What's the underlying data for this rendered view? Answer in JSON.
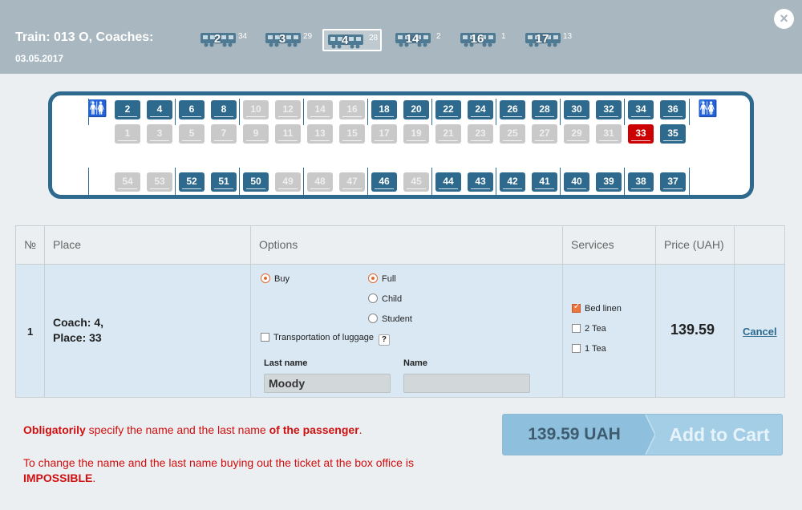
{
  "header": {
    "title": "Train: 013 O, Coaches:",
    "date": "03.05.2017",
    "close_label": "×",
    "coaches": [
      {
        "number": "2",
        "free": "34",
        "selected": false
      },
      {
        "number": "3",
        "free": "29",
        "selected": false
      },
      {
        "number": "4",
        "free": "28",
        "selected": true
      },
      {
        "number": "14",
        "free": "2",
        "selected": false
      },
      {
        "number": "16",
        "free": "1",
        "selected": false
      },
      {
        "number": "17",
        "free": "13",
        "selected": false
      }
    ]
  },
  "scheme": {
    "compartments": [
      {
        "top_upper": "2",
        "top_upper_status": "free",
        "top_lower": "1",
        "top_lower_status": "taken",
        "right_upper": "4",
        "right_upper_status": "free",
        "right_lower": "3",
        "right_lower_status": "taken",
        "side_left": "54",
        "side_left_status": "taken",
        "side_right": "53",
        "side_right_status": "taken"
      },
      {
        "top_upper": "6",
        "top_upper_status": "free",
        "top_lower": "5",
        "top_lower_status": "taken",
        "right_upper": "8",
        "right_upper_status": "free",
        "right_lower": "7",
        "right_lower_status": "taken",
        "side_left": "52",
        "side_left_status": "free",
        "side_right": "51",
        "side_right_status": "free"
      },
      {
        "top_upper": "10",
        "top_upper_status": "taken",
        "top_lower": "9",
        "top_lower_status": "taken",
        "right_upper": "12",
        "right_upper_status": "taken",
        "right_lower": "11",
        "right_lower_status": "taken",
        "side_left": "50",
        "side_left_status": "free",
        "side_right": "49",
        "side_right_status": "taken"
      },
      {
        "top_upper": "14",
        "top_upper_status": "taken",
        "top_lower": "13",
        "top_lower_status": "taken",
        "right_upper": "16",
        "right_upper_status": "taken",
        "right_lower": "15",
        "right_lower_status": "taken",
        "side_left": "48",
        "side_left_status": "taken",
        "side_right": "47",
        "side_right_status": "taken"
      },
      {
        "top_upper": "18",
        "top_upper_status": "free",
        "top_lower": "17",
        "top_lower_status": "taken",
        "right_upper": "20",
        "right_upper_status": "free",
        "right_lower": "19",
        "right_lower_status": "taken",
        "side_left": "46",
        "side_left_status": "free",
        "side_right": "45",
        "side_right_status": "taken"
      },
      {
        "top_upper": "22",
        "top_upper_status": "free",
        "top_lower": "21",
        "top_lower_status": "taken",
        "right_upper": "24",
        "right_upper_status": "free",
        "right_lower": "23",
        "right_lower_status": "taken",
        "side_left": "44",
        "side_left_status": "free",
        "side_right": "43",
        "side_right_status": "free"
      },
      {
        "top_upper": "26",
        "top_upper_status": "free",
        "top_lower": "25",
        "top_lower_status": "taken",
        "right_upper": "28",
        "right_upper_status": "free",
        "right_lower": "27",
        "right_lower_status": "taken",
        "side_left": "42",
        "side_left_status": "free",
        "side_right": "41",
        "side_right_status": "free"
      },
      {
        "top_upper": "30",
        "top_upper_status": "free",
        "top_lower": "29",
        "top_lower_status": "taken",
        "right_upper": "32",
        "right_upper_status": "free",
        "right_lower": "31",
        "right_lower_status": "taken",
        "side_left": "40",
        "side_left_status": "free",
        "side_right": "39",
        "side_right_status": "free"
      },
      {
        "top_upper": "34",
        "top_upper_status": "free",
        "top_lower": "33",
        "top_lower_status": "selected",
        "right_upper": "36",
        "right_upper_status": "free",
        "right_lower": "35",
        "right_lower_status": "free",
        "side_left": "38",
        "side_left_status": "free",
        "side_right": "37",
        "side_right_status": "free"
      }
    ]
  },
  "table": {
    "headers": {
      "no": "№",
      "place": "Place",
      "options": "Options",
      "services": "Services",
      "price": "Price (UAH)"
    },
    "row": {
      "no": "1",
      "coach_line": "Coach: 4,",
      "place_line": "Place: 33",
      "buy_label": "Buy",
      "full_label": "Full",
      "child_label": "Child",
      "student_label": "Student",
      "luggage_label": "Transportation of luggage",
      "help_label": "?",
      "last_name_label": "Last name",
      "last_name_value": "Moody",
      "name_label": "Name",
      "name_value": "",
      "bed_linen_label": "Bed linen",
      "tea2_label": "2 Tea",
      "tea1_label": "1 Tea",
      "price": "139.59",
      "cancel_label": "Cancel"
    }
  },
  "notes": {
    "line1_part1": "Obligatorily",
    "line1_part2": " specify the name and the last name ",
    "line1_part3": "of the passenger",
    "line1_part4": ".",
    "line2_part1": "To change the name and the last name buying out the ticket at the box office is ",
    "line2_part2": "IMPOSSIBLE",
    "line2_part3": "."
  },
  "cart": {
    "price": "139.59 UAH",
    "label": "Add to Cart"
  },
  "colors": {
    "accent": "#2e6a8e",
    "selected_seat": "#cc0000",
    "header_bg": "#a9b7c0",
    "warning": "#d01010"
  }
}
